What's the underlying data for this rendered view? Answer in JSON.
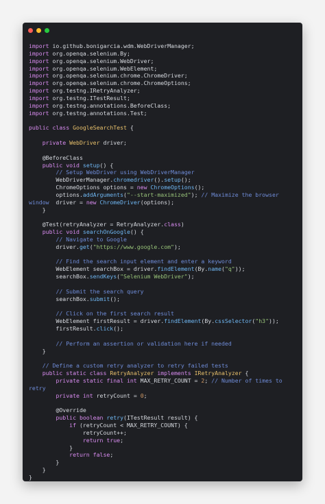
{
  "window": {
    "controls": [
      "close",
      "minimize",
      "maximize"
    ]
  },
  "code": {
    "language": "java",
    "lines": [
      [
        [
          "kw",
          "import"
        ],
        [
          "tx",
          " io.github.bonigarcia.wdm.WebDriverManager;"
        ]
      ],
      [
        [
          "kw",
          "import"
        ],
        [
          "tx",
          " org.openqa.selenium.By;"
        ]
      ],
      [
        [
          "kw",
          "import"
        ],
        [
          "tx",
          " org.openqa.selenium.WebDriver;"
        ]
      ],
      [
        [
          "kw",
          "import"
        ],
        [
          "tx",
          " org.openqa.selenium.WebElement;"
        ]
      ],
      [
        [
          "kw",
          "import"
        ],
        [
          "tx",
          " org.openqa.selenium.chrome.ChromeDriver;"
        ]
      ],
      [
        [
          "kw",
          "import"
        ],
        [
          "tx",
          " org.openqa.selenium.chrome.ChromeOptions;"
        ]
      ],
      [
        [
          "kw",
          "import"
        ],
        [
          "tx",
          " org.testng.IRetryAnalyzer;"
        ]
      ],
      [
        [
          "kw",
          "import"
        ],
        [
          "tx",
          " org.testng.ITestResult;"
        ]
      ],
      [
        [
          "kw",
          "import"
        ],
        [
          "tx",
          " org.testng.annotations.BeforeClass;"
        ]
      ],
      [
        [
          "kw",
          "import"
        ],
        [
          "tx",
          " org.testng.annotations.Test;"
        ]
      ],
      [],
      [
        [
          "kw",
          "public class"
        ],
        [
          "tx",
          " "
        ],
        [
          "ty",
          "GoogleSearchTest"
        ],
        [
          "tx",
          " {"
        ]
      ],
      [],
      [
        [
          "tx",
          "    "
        ],
        [
          "kw",
          "private"
        ],
        [
          "tx",
          " "
        ],
        [
          "ty",
          "WebDriver"
        ],
        [
          "tx",
          " driver;"
        ]
      ],
      [],
      [
        [
          "tx",
          "    "
        ],
        [
          "an",
          "@BeforeClass"
        ]
      ],
      [
        [
          "tx",
          "    "
        ],
        [
          "kw",
          "public void"
        ],
        [
          "tx",
          " "
        ],
        [
          "fn",
          "setup"
        ],
        [
          "tx",
          "() {"
        ]
      ],
      [
        [
          "tx",
          "        "
        ],
        [
          "cm",
          "// Setup WebDriver using WebDriverManager"
        ]
      ],
      [
        [
          "tx",
          "        WebDriverManager."
        ],
        [
          "fn",
          "chromedriver"
        ],
        [
          "tx",
          "()."
        ],
        [
          "fn",
          "setup"
        ],
        [
          "tx",
          "();"
        ]
      ],
      [
        [
          "tx",
          "        ChromeOptions options = "
        ],
        [
          "kw",
          "new"
        ],
        [
          "tx",
          " "
        ],
        [
          "fn",
          "ChromeOptions"
        ],
        [
          "tx",
          "();"
        ]
      ],
      [
        [
          "tx",
          "        options."
        ],
        [
          "fn",
          "addArguments"
        ],
        [
          "tx",
          "("
        ],
        [
          "st",
          "\"--start-maximized\""
        ],
        [
          "tx",
          "); "
        ],
        [
          "cm",
          "// Maximize the browser"
        ]
      ],
      [
        [
          "cm",
          "window"
        ],
        [
          "tx",
          "  driver = "
        ],
        [
          "kw",
          "new"
        ],
        [
          "tx",
          " "
        ],
        [
          "fn",
          "ChromeDriver"
        ],
        [
          "tx",
          "(options);"
        ]
      ],
      [
        [
          "tx",
          "    }"
        ]
      ],
      [],
      [
        [
          "tx",
          "    "
        ],
        [
          "an",
          "@Test"
        ],
        [
          "tx",
          "(retryAnalyzer = RetryAnalyzer."
        ],
        [
          "kw",
          "class"
        ],
        [
          "tx",
          ")"
        ]
      ],
      [
        [
          "tx",
          "    "
        ],
        [
          "kw",
          "public void"
        ],
        [
          "tx",
          " "
        ],
        [
          "fn",
          "searchOnGoogle"
        ],
        [
          "tx",
          "() {"
        ]
      ],
      [
        [
          "tx",
          "        "
        ],
        [
          "cm",
          "// Navigate to Google"
        ]
      ],
      [
        [
          "tx",
          "        driver."
        ],
        [
          "fn",
          "get"
        ],
        [
          "tx",
          "("
        ],
        [
          "st",
          "\"https://www.google.com\""
        ],
        [
          "tx",
          ");"
        ]
      ],
      [],
      [
        [
          "tx",
          "        "
        ],
        [
          "cm",
          "// Find the search input element and enter a keyword"
        ]
      ],
      [
        [
          "tx",
          "        WebElement searchBox = driver."
        ],
        [
          "fn",
          "findElement"
        ],
        [
          "tx",
          "(By."
        ],
        [
          "fn",
          "name"
        ],
        [
          "tx",
          "("
        ],
        [
          "st",
          "\"q\""
        ],
        [
          "tx",
          "));"
        ]
      ],
      [
        [
          "tx",
          "        searchBox."
        ],
        [
          "fn",
          "sendKeys"
        ],
        [
          "tx",
          "("
        ],
        [
          "st",
          "\"Selenium WebDriver\""
        ],
        [
          "tx",
          ");"
        ]
      ],
      [],
      [
        [
          "tx",
          "        "
        ],
        [
          "cm",
          "// Submit the search query"
        ]
      ],
      [
        [
          "tx",
          "        searchBox."
        ],
        [
          "fn",
          "submit"
        ],
        [
          "tx",
          "();"
        ]
      ],
      [],
      [
        [
          "tx",
          "        "
        ],
        [
          "cm",
          "// Click on the first search result"
        ]
      ],
      [
        [
          "tx",
          "        WebElement firstResult = driver."
        ],
        [
          "fn",
          "findElement"
        ],
        [
          "tx",
          "(By."
        ],
        [
          "fn",
          "cssSelector"
        ],
        [
          "tx",
          "("
        ],
        [
          "st",
          "\"h3\""
        ],
        [
          "tx",
          "));"
        ]
      ],
      [
        [
          "tx",
          "        firstResult."
        ],
        [
          "fn",
          "click"
        ],
        [
          "tx",
          "();"
        ]
      ],
      [],
      [
        [
          "tx",
          "        "
        ],
        [
          "cm",
          "// Perform an assertion or validation here if needed"
        ]
      ],
      [
        [
          "tx",
          "    }"
        ]
      ],
      [],
      [
        [
          "tx",
          "    "
        ],
        [
          "cm",
          "// Define a custom retry analyzer to retry failed tests"
        ]
      ],
      [
        [
          "tx",
          "    "
        ],
        [
          "kw",
          "public static class"
        ],
        [
          "tx",
          " "
        ],
        [
          "ty",
          "RetryAnalyzer"
        ],
        [
          "tx",
          " "
        ],
        [
          "kw",
          "implements"
        ],
        [
          "tx",
          " "
        ],
        [
          "ty",
          "IRetryAnalyzer"
        ],
        [
          "tx",
          " {"
        ]
      ],
      [
        [
          "tx",
          "        "
        ],
        [
          "kw",
          "private static final int"
        ],
        [
          "tx",
          " MAX_RETRY_COUNT = "
        ],
        [
          "nu",
          "2"
        ],
        [
          "tx",
          "; "
        ],
        [
          "cm",
          "// Number of times to"
        ]
      ],
      [
        [
          "cm",
          "retry"
        ]
      ],
      [
        [
          "tx",
          "        "
        ],
        [
          "kw",
          "private int"
        ],
        [
          "tx",
          " retryCount = "
        ],
        [
          "nu",
          "0"
        ],
        [
          "tx",
          ";"
        ]
      ],
      [],
      [
        [
          "tx",
          "        "
        ],
        [
          "an",
          "@Override"
        ]
      ],
      [
        [
          "tx",
          "        "
        ],
        [
          "kw",
          "public boolean"
        ],
        [
          "tx",
          " "
        ],
        [
          "fn",
          "retry"
        ],
        [
          "tx",
          "(ITestResult result) {"
        ]
      ],
      [
        [
          "tx",
          "            "
        ],
        [
          "kw",
          "if"
        ],
        [
          "tx",
          " (retryCount < MAX_RETRY_COUNT) {"
        ]
      ],
      [
        [
          "tx",
          "                retryCount++;"
        ]
      ],
      [
        [
          "tx",
          "                "
        ],
        [
          "kw",
          "return"
        ],
        [
          "tx",
          " "
        ],
        [
          "kw",
          "true"
        ],
        [
          "tx",
          ";"
        ]
      ],
      [
        [
          "tx",
          "            }"
        ]
      ],
      [
        [
          "tx",
          "            "
        ],
        [
          "kw",
          "return"
        ],
        [
          "tx",
          " "
        ],
        [
          "kw",
          "false"
        ],
        [
          "tx",
          ";"
        ]
      ],
      [
        [
          "tx",
          "        }"
        ]
      ],
      [
        [
          "tx",
          "    }"
        ]
      ],
      [
        [
          "tx",
          "}"
        ]
      ]
    ]
  }
}
